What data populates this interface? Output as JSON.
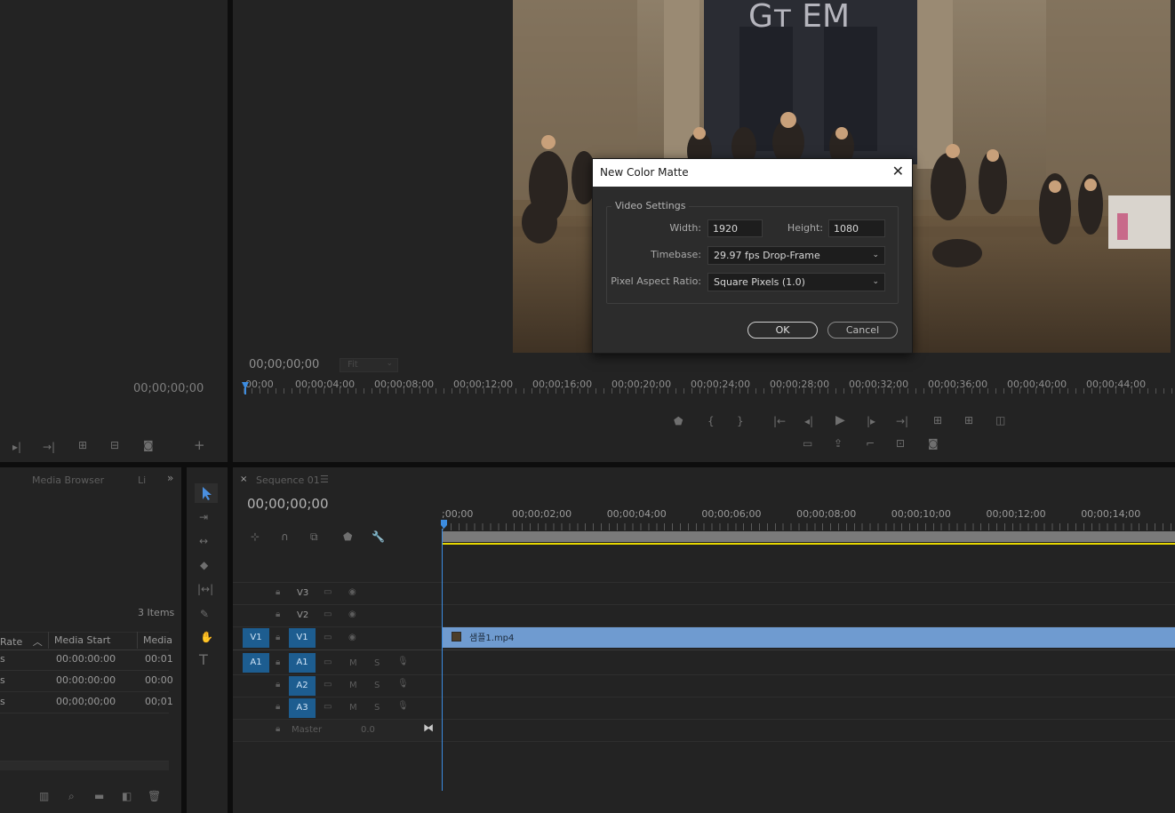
{
  "source_monitor": {
    "timecode": "00;00;00;00"
  },
  "program_monitor": {
    "timecode": "00;00;00;00",
    "zoom": "Fit",
    "ruler_labels": [
      "00;00",
      "00;00;04;00",
      "00;00;08;00",
      "00;00;12;00",
      "00;00;16;00",
      "00;00;20;00",
      "00;00;24;00",
      "00;00;28;00",
      "00;00;32;00",
      "00;00;36;00",
      "00;00;40;00",
      "00;00;44;00"
    ]
  },
  "dialog": {
    "title": "New Color Matte",
    "section_label": "Video Settings",
    "width_label": "Width:",
    "width_value": "1920",
    "height_label": "Height:",
    "height_value": "1080",
    "timebase_label": "Timebase:",
    "timebase_value": "29.97 fps Drop-Frame",
    "par_label": "Pixel Aspect Ratio:",
    "par_value": "Square Pixels (1.0)",
    "ok_label": "OK",
    "cancel_label": "Cancel"
  },
  "project_panel": {
    "tabs": [
      "Media Browser",
      "Li"
    ],
    "items_count": "3 Items",
    "columns": [
      "Rate",
      "Media Start",
      "Media"
    ],
    "rows": [
      {
        "rate": "s",
        "start": "00:00:00:00",
        "media": "00:01"
      },
      {
        "rate": "s",
        "start": "00:00:00:00",
        "media": "00:00"
      },
      {
        "rate": "s",
        "start": "00;00;00;00",
        "media": "00;01"
      }
    ]
  },
  "timeline": {
    "sequence_name": "Sequence 01",
    "timecode": "00;00;00;00",
    "ruler_labels": [
      ";00;00",
      "00;00;02;00",
      "00;00;04;00",
      "00;00;06;00",
      "00;00;08;00",
      "00;00;10;00",
      "00;00;12;00",
      "00;00;14;00"
    ],
    "tracks": [
      {
        "name": "V3",
        "source": "",
        "type": "video"
      },
      {
        "name": "V2",
        "source": "",
        "type": "video"
      },
      {
        "name": "V1",
        "source": "V1",
        "type": "video"
      },
      {
        "name": "A1",
        "source": "A1",
        "type": "audio"
      },
      {
        "name": "A2",
        "source": "",
        "type": "audio"
      },
      {
        "name": "A3",
        "source": "",
        "type": "audio"
      }
    ],
    "master_label": "Master",
    "master_value": "0.0",
    "clip_name": "샘플1.mp4",
    "mute_label": "M",
    "solo_label": "S"
  },
  "colors": {
    "accent": "#1d5d90",
    "clip": "#6f9bd0",
    "playhead": "#3c8ce0",
    "workarea": "#e6d600"
  }
}
